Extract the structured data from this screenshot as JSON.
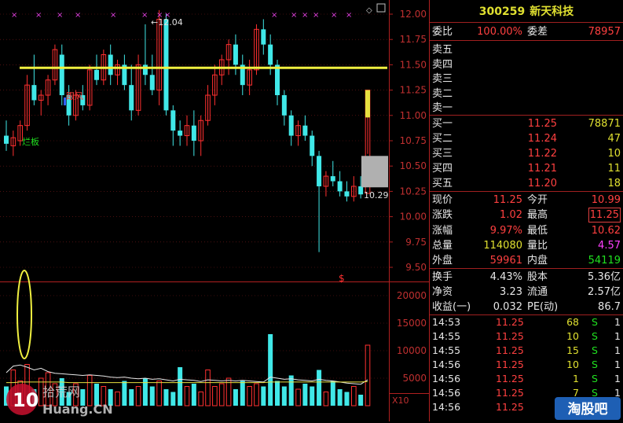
{
  "stock": {
    "code": "300259",
    "name": "新天科技"
  },
  "order_ratio": {
    "label1": "委比",
    "value1": "100.00%",
    "label2": "委差",
    "value2": "78957"
  },
  "asks": [
    {
      "label": "卖五",
      "price": "",
      "vol": ""
    },
    {
      "label": "卖四",
      "price": "",
      "vol": ""
    },
    {
      "label": "卖三",
      "price": "",
      "vol": ""
    },
    {
      "label": "卖二",
      "price": "",
      "vol": ""
    },
    {
      "label": "卖一",
      "price": "",
      "vol": ""
    }
  ],
  "bids": [
    {
      "label": "买一",
      "price": "11.25",
      "vol": "78871"
    },
    {
      "label": "买二",
      "price": "11.24",
      "vol": "47"
    },
    {
      "label": "买三",
      "price": "11.22",
      "vol": "10"
    },
    {
      "label": "买四",
      "price": "11.21",
      "vol": "11"
    },
    {
      "label": "买五",
      "price": "11.20",
      "vol": "18"
    }
  ],
  "quote": [
    {
      "l1": "现价",
      "v1": "11.25",
      "l2": "今开",
      "v2": "10.99"
    },
    {
      "l1": "涨跌",
      "v1": "1.02",
      "l2": "最高",
      "v2": "11.25"
    },
    {
      "l1": "涨幅",
      "v1": "9.97%",
      "l2": "最低",
      "v2": "10.62"
    },
    {
      "l1": "总量",
      "v1": "114080",
      "l2": "量比",
      "v2": "4.57"
    },
    {
      "l1": "外盘",
      "v1": "59961",
      "l2": "内盘",
      "v2": "54119"
    }
  ],
  "fundamentals": [
    {
      "l1": "换手",
      "v1": "4.43%",
      "l2": "股本",
      "v2": "5.36亿"
    },
    {
      "l1": "净资",
      "v1": "3.23",
      "l2": "流通",
      "v2": "2.57亿"
    },
    {
      "l1": "收益(一)",
      "v1": "0.032",
      "l2": "PE(动)",
      "v2": "86.7"
    }
  ],
  "trades": [
    {
      "time": "14:53",
      "price": "11.25",
      "qty": "68",
      "side": "S",
      "n": "1"
    },
    {
      "time": "14:55",
      "price": "11.25",
      "qty": "10",
      "side": "S",
      "n": "1"
    },
    {
      "time": "14:55",
      "price": "11.25",
      "qty": "15",
      "side": "S",
      "n": "1"
    },
    {
      "time": "14:56",
      "price": "11.25",
      "qty": "10",
      "side": "S",
      "n": "1"
    },
    {
      "time": "14:56",
      "price": "11.25",
      "qty": "1",
      "side": "S",
      "n": "1"
    },
    {
      "time": "14:56",
      "price": "11.25",
      "qty": "7",
      "side": "S",
      "n": "1"
    },
    {
      "time": "14:56",
      "price": "11.25",
      "qty": "",
      "side": "",
      "n": ""
    }
  ],
  "chart_data": {
    "type": "candlestick",
    "price_ticks": [
      "12.00",
      "11.75",
      "11.50",
      "11.25",
      "11.00",
      "10.75",
      "10.50",
      "10.25",
      "10.00",
      "9.75",
      "9.50"
    ],
    "volume_ticks": [
      "20000",
      "15000",
      "10000",
      "5000"
    ],
    "price_range": [
      9.5,
      12.0
    ],
    "volume_range": [
      0,
      22000
    ],
    "resistance_level": 11.47,
    "annotations": {
      "high_label": "12.04",
      "low_label": "10.29",
      "limit_up_tag": "烂板",
      "signal_tag": "跟风",
      "volume_marker": "$",
      "zoom": "X10"
    },
    "candles": [
      [
        10.8,
        10.95,
        10.65,
        10.72
      ],
      [
        10.7,
        10.85,
        10.6,
        10.78
      ],
      [
        10.75,
        10.95,
        10.7,
        10.9
      ],
      [
        10.9,
        11.4,
        10.85,
        11.3
      ],
      [
        11.3,
        11.6,
        11.1,
        11.15
      ],
      [
        11.15,
        11.25,
        11.0,
        11.2
      ],
      [
        11.2,
        11.4,
        11.1,
        11.35
      ],
      [
        11.35,
        11.7,
        11.3,
        11.65
      ],
      [
        11.6,
        11.7,
        11.1,
        11.2
      ],
      [
        11.2,
        11.3,
        10.9,
        11.0
      ],
      [
        11.0,
        11.25,
        10.95,
        11.2
      ],
      [
        11.2,
        11.3,
        11.05,
        11.1
      ],
      [
        11.1,
        11.5,
        11.05,
        11.45
      ],
      [
        11.45,
        11.6,
        11.3,
        11.35
      ],
      [
        11.35,
        11.65,
        11.3,
        11.6
      ],
      [
        11.6,
        11.7,
        11.3,
        11.4
      ],
      [
        11.4,
        11.55,
        11.3,
        11.5
      ],
      [
        11.5,
        11.6,
        11.25,
        11.3
      ],
      [
        11.3,
        11.5,
        10.95,
        11.05
      ],
      [
        11.05,
        11.6,
        11.0,
        11.5
      ],
      [
        11.5,
        11.9,
        11.3,
        11.4
      ],
      [
        11.4,
        11.6,
        11.2,
        11.25
      ],
      [
        11.25,
        12.04,
        11.1,
        11.95
      ],
      [
        11.95,
        12.0,
        11.0,
        11.05
      ],
      [
        11.05,
        11.1,
        10.7,
        10.85
      ],
      [
        10.85,
        10.95,
        10.7,
        10.8
      ],
      [
        10.8,
        11.0,
        10.7,
        10.9
      ],
      [
        10.9,
        11.05,
        10.6,
        10.75
      ],
      [
        10.75,
        11.0,
        10.6,
        10.95
      ],
      [
        10.95,
        11.3,
        10.9,
        11.2
      ],
      [
        11.2,
        11.5,
        11.1,
        11.4
      ],
      [
        11.4,
        11.6,
        11.3,
        11.55
      ],
      [
        11.55,
        11.75,
        11.4,
        11.7
      ],
      [
        11.7,
        11.8,
        11.4,
        11.5
      ],
      [
        11.5,
        11.6,
        11.2,
        11.3
      ],
      [
        11.3,
        11.55,
        11.2,
        11.45
      ],
      [
        11.45,
        11.9,
        11.4,
        11.85
      ],
      [
        11.85,
        11.95,
        11.6,
        11.7
      ],
      [
        11.7,
        11.8,
        11.4,
        11.5
      ],
      [
        11.5,
        11.55,
        11.1,
        11.2
      ],
      [
        11.2,
        11.25,
        10.9,
        11.0
      ],
      [
        11.0,
        11.05,
        10.7,
        10.8
      ],
      [
        10.8,
        10.95,
        10.7,
        10.9
      ],
      [
        10.9,
        11.0,
        10.75,
        10.8
      ],
      [
        10.8,
        10.85,
        10.5,
        10.6
      ],
      [
        10.6,
        10.65,
        9.65,
        10.3
      ],
      [
        10.3,
        10.45,
        10.2,
        10.4
      ],
      [
        10.4,
        10.55,
        10.3,
        10.35
      ],
      [
        10.35,
        10.45,
        10.2,
        10.25
      ],
      [
        10.25,
        10.35,
        10.15,
        10.2
      ],
      [
        10.2,
        10.4,
        10.15,
        10.3
      ],
      [
        10.3,
        10.4,
        10.18,
        10.22
      ],
      [
        10.23,
        11.25,
        10.62,
        11.25
      ]
    ],
    "volumes": [
      3500,
      6500,
      4500,
      7500,
      3000,
      5000,
      6000,
      4000,
      5000,
      2500,
      4000,
      3000,
      5500,
      4000,
      3500,
      3000,
      2500,
      4500,
      3000,
      3500,
      5000,
      3500,
      4500,
      3000,
      2500,
      7000,
      3500,
      4000,
      2500,
      6500,
      3500,
      4000,
      5000,
      3000,
      4500,
      3500,
      4000,
      3500,
      13000,
      4500,
      3500,
      5500,
      3000,
      4000,
      3500,
      6500,
      2500,
      4500,
      3000,
      2500,
      3500,
      2000,
      11000
    ],
    "volume_ma": [
      6000,
      7200,
      7400,
      7000,
      6500,
      6800,
      6200,
      5900,
      5800,
      5700,
      5600,
      5500,
      5600,
      5500,
      5400,
      5200,
      5100,
      5200,
      5000,
      4900,
      5000,
      4800,
      4900,
      4700,
      4500,
      4800,
      4700,
      4600,
      4400,
      4700,
      4600,
      4500,
      4600,
      4500,
      4600,
      4500,
      4400,
      4300,
      5200,
      5000,
      4800,
      4900,
      4700,
      4600,
      4500,
      4800,
      4600,
      4500,
      4300,
      4100,
      4000,
      3900,
      4700
    ],
    "volume_ma2": [
      4200,
      4200,
      4300,
      4300,
      4300,
      4300,
      4300,
      4300,
      4300,
      4200,
      4200,
      4200,
      4200,
      4200,
      4200,
      4200,
      4200,
      4200,
      4200,
      4200,
      4200,
      4200,
      4200,
      4200,
      4200,
      4200,
      4200,
      4200,
      4200,
      4200,
      4200,
      4200,
      4200,
      4200,
      4200,
      4200,
      4200,
      4200,
      4300,
      4300,
      4300,
      4300,
      4300,
      4300,
      4300,
      4300,
      4300,
      4300,
      4300,
      4300,
      4300,
      4300,
      4400
    ]
  },
  "watermark": {
    "left_text": "拾荒网",
    "left_sub": "Huang.CN",
    "right_text": "淘股吧"
  }
}
